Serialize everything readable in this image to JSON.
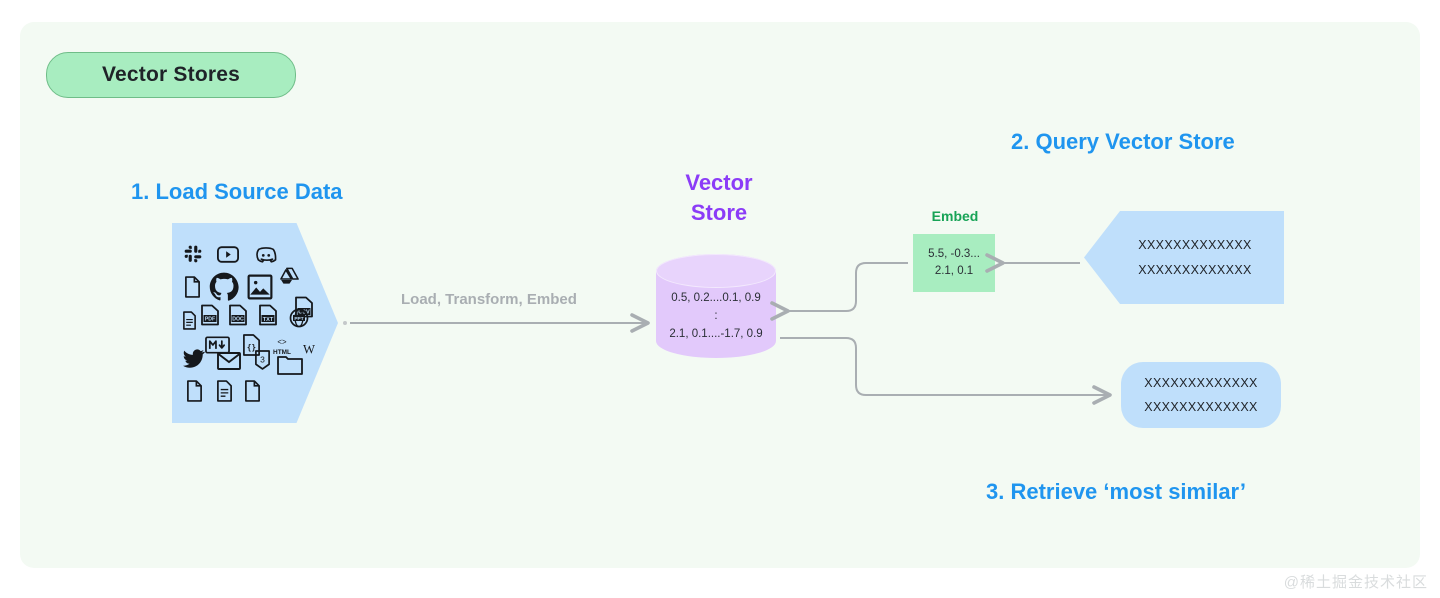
{
  "panel": {
    "background": "#f3faf3"
  },
  "title": {
    "label": "Vector Stores",
    "fill": "#a8edc0",
    "border": "#6fbd88"
  },
  "steps": {
    "step1": "1. Load Source Data",
    "step2": "2. Query Vector Store",
    "step3": "3. Retrieve ‘most similar’",
    "color": "#1f95ef"
  },
  "vector_store": {
    "title_line1": "Vector",
    "title_line2": "Store",
    "title_color": "#8b3cf7",
    "cylinder_fill": "#e2c9fb",
    "rows": [
      "0.5, 0.2....0.1, 0.9",
      ":",
      "2.1, 0.1....-1.7, 0.9"
    ]
  },
  "source": {
    "fill": "#bfdffb",
    "icons": [
      "slack-icon",
      "youtube-icon",
      "discord-icon",
      "document-icon",
      "github-icon",
      "image-icon",
      "google-drive-icon",
      "file-icon",
      "pdf-file-icon",
      "doc-file-icon",
      "txt-file-icon",
      "ppt-file-icon",
      "markdown-icon",
      "json-file-icon",
      "html-icon",
      "wikipedia-icon",
      "twitter-icon",
      "email-icon",
      "css3-icon",
      "folder-icon",
      "blank-document-icon",
      "text-document-icon",
      "page-icon"
    ]
  },
  "pipeline": {
    "label": "Load, Transform, Embed",
    "color": "#a9aeb2"
  },
  "embed": {
    "label": "Embed",
    "label_color": "#17a356",
    "fill": "#a8edc0",
    "line1": "5.5, -0.3...",
    "line2": "2.1, 0.1"
  },
  "query": {
    "fill": "#bfdffb",
    "line1": "XXXXXXXXXXXXX",
    "line2": "XXXXXXXXXXXXX"
  },
  "result": {
    "fill": "#bfdffb",
    "line1": "XXXXXXXXXXXXX",
    "line2": "XXXXXXXXXXXXX"
  },
  "watermark": "@稀土掘金技术社区"
}
